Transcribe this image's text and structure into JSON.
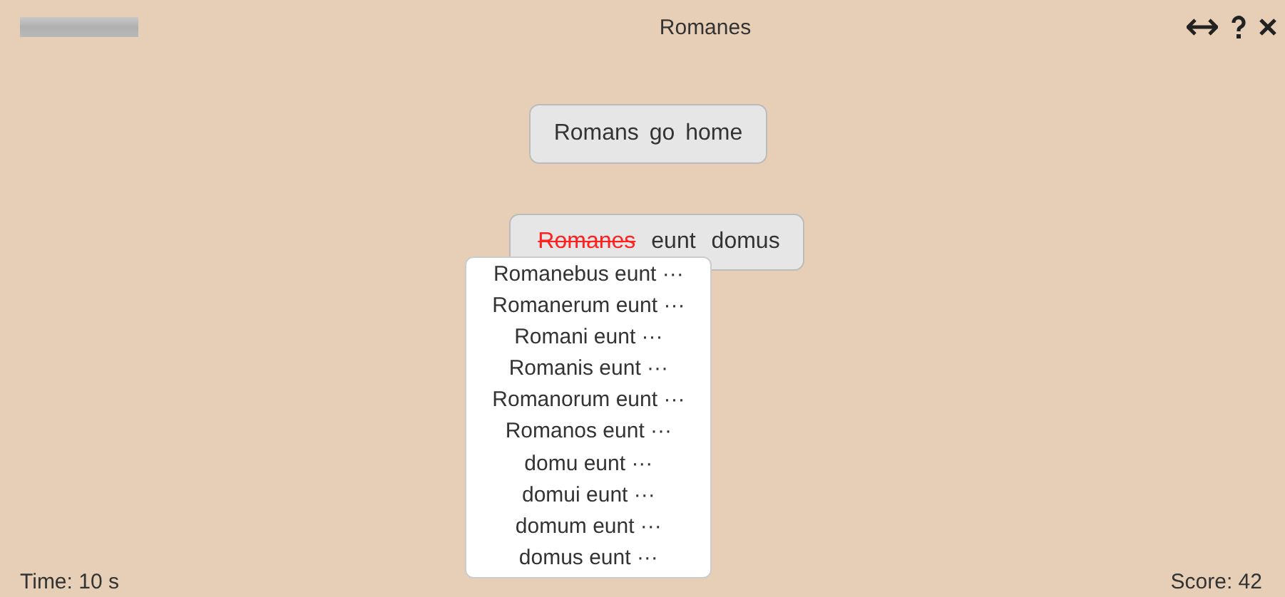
{
  "header": {
    "progress": {
      "level": 1
    },
    "title": "Romanes",
    "icons": [
      {
        "kind": "resize"
      },
      {
        "kind": "help"
      },
      {
        "kind": "close"
      }
    ]
  },
  "prompt": "Romans go home",
  "answer": {
    "words": [
      {
        "text": "Romanes",
        "wrong": true
      },
      {
        "text": "eunt",
        "wrong": false
      },
      {
        "text": "domus",
        "wrong": false
      }
    ]
  },
  "suggestions": [
    "Romanebus eunt ···",
    "Romanerum eunt ···",
    "Romani eunt ···",
    "Romanis eunt ···",
    "Romanorum eunt ···",
    "Romanos eunt ···",
    "domu eunt ···",
    "domui eunt ···",
    "domum eunt ···",
    "domus eunt ···"
  ],
  "footer": {
    "time": "Time: 10 s",
    "score": "Score: 42"
  }
}
